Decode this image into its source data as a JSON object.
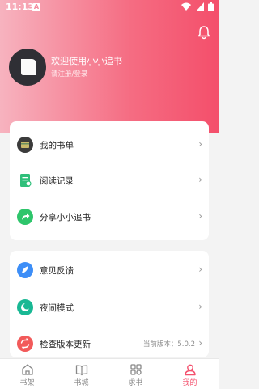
{
  "status_bar": {
    "time": "11:13",
    "notification_icon_letter": "A"
  },
  "profile": {
    "name": "欢迎使用小小追书",
    "subtitle": "请注册/登录"
  },
  "menu_card_1": [
    {
      "label": "我的书单",
      "icon": "booklist-icon",
      "color": "#3b3b3b"
    },
    {
      "label": "阅读记录",
      "icon": "reading-record-icon",
      "color": "#2fbf7a"
    },
    {
      "label": "分享小小追书",
      "icon": "share-icon",
      "color": "#2ec56b"
    }
  ],
  "menu_card_2": [
    {
      "label": "意见反馈",
      "icon": "feedback-icon",
      "color": "#3d8ef7"
    },
    {
      "label": "夜间模式",
      "icon": "night-mode-icon",
      "color": "#19b894"
    },
    {
      "label": "检查版本更新",
      "icon": "update-icon",
      "color": "#f25a5a",
      "version": "当前版本：5.0.2"
    }
  ],
  "tabs": [
    {
      "label": "书架",
      "icon": "bookshelf-icon"
    },
    {
      "label": "书城",
      "icon": "bookstore-icon"
    },
    {
      "label": "求书",
      "icon": "request-book-icon"
    },
    {
      "label": "我的",
      "icon": "profile-icon",
      "active": true
    }
  ],
  "colors": {
    "accent": "#f4506d",
    "header_start": "#f7b3bf",
    "header_end": "#f44f6b"
  }
}
